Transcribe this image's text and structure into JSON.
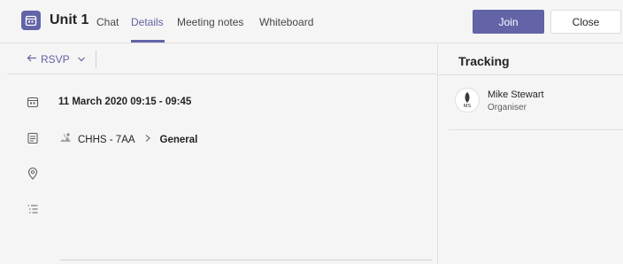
{
  "header": {
    "title": "Unit 1",
    "tabs": [
      {
        "label": "Chat",
        "active": false
      },
      {
        "label": "Details",
        "active": true
      },
      {
        "label": "Meeting notes",
        "active": false
      },
      {
        "label": "Whiteboard",
        "active": false
      }
    ],
    "join_label": "Join",
    "close_label": "Close",
    "meeting_icon": "calendar-icon"
  },
  "toolbar": {
    "rsvp_label": "RSVP",
    "rsvp_icon": "reply-arrow-icon",
    "dropdown_icon": "chevron-down-icon"
  },
  "details": {
    "datetime": "11 March 2020 09:15 - 09:45",
    "team": "CHHS - 7AA",
    "channel": "General",
    "icons": [
      "calendar-icon",
      "channel-icon",
      "location-icon",
      "list-icon"
    ]
  },
  "tracking": {
    "title": "Tracking",
    "people": [
      {
        "name": "Mike Stewart",
        "role": "Organiser",
        "initials": "MS"
      }
    ]
  },
  "colors": {
    "accent": "#6264a7",
    "background": "#f5f5f5",
    "divider": "#e1dfdd"
  }
}
